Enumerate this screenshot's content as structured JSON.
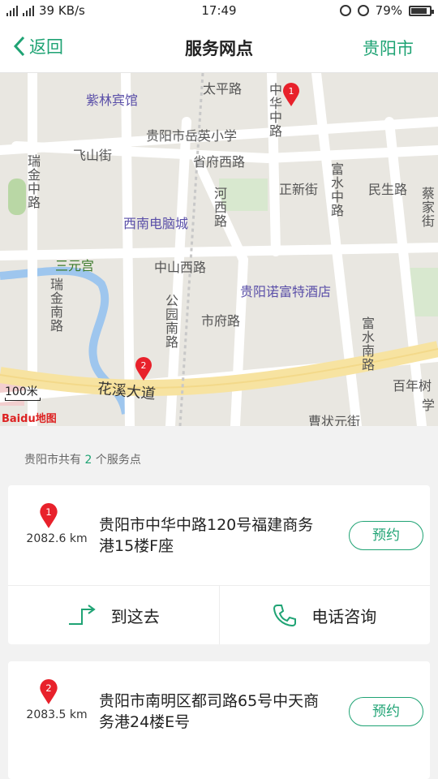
{
  "status": {
    "net": "39 KB/s",
    "time": "17:49",
    "battery": "79%"
  },
  "nav": {
    "back_label": "返回",
    "title": "服务网点",
    "city": "贵阳市"
  },
  "map": {
    "labels": {
      "zilin": "紫林宾馆",
      "taiping": "太平路",
      "zhonghua": "中华中路",
      "yueying": "贵阳市岳英小学",
      "feishan": "飞山街",
      "shengfu": "省府西路",
      "ruijin": "瑞金中路",
      "zhengxin": "正新街",
      "fushui": "富水中路",
      "minsheng": "民生路",
      "caijia": "蔡家街",
      "hexi": "河西路",
      "xinan": "西南电脑城",
      "sanyuan": "三元宫",
      "zhongshan": "中山西路",
      "novotel": "贵阳诺富特酒店",
      "ruijinnan": "瑞金南路",
      "gongyuan": "公园南路",
      "shifu": "市府路",
      "fushuinan": "富水南路",
      "huaxi": "花溪大道",
      "bainian": "百年树",
      "xue": "学",
      "caozhuang": "曹状元街"
    },
    "scale_label": "100米",
    "logo_text": "Baidu地图",
    "pins": [
      "1",
      "2"
    ]
  },
  "summary": {
    "prefix": "贵阳市共有",
    "count": "2",
    "suffix": "个服务点"
  },
  "outlets": [
    {
      "index": "1",
      "distance": "2082.6 km",
      "address": "贵阳市中华中路120号福建商务港15楼F座",
      "book_label": "预约",
      "go_label": "到这去",
      "call_label": "电话咨询"
    },
    {
      "index": "2",
      "distance": "2083.5 km",
      "address": "贵阳市南明区都司路65号中天商务港24楼E号",
      "book_label": "预约"
    }
  ],
  "colors": {
    "accent": "#1fa374",
    "pin": "#e8212b"
  },
  "icons": {
    "back": "chevron-left-icon",
    "directions": "route-arrow-icon",
    "phone": "phone-icon",
    "pin": "map-pin-icon"
  }
}
